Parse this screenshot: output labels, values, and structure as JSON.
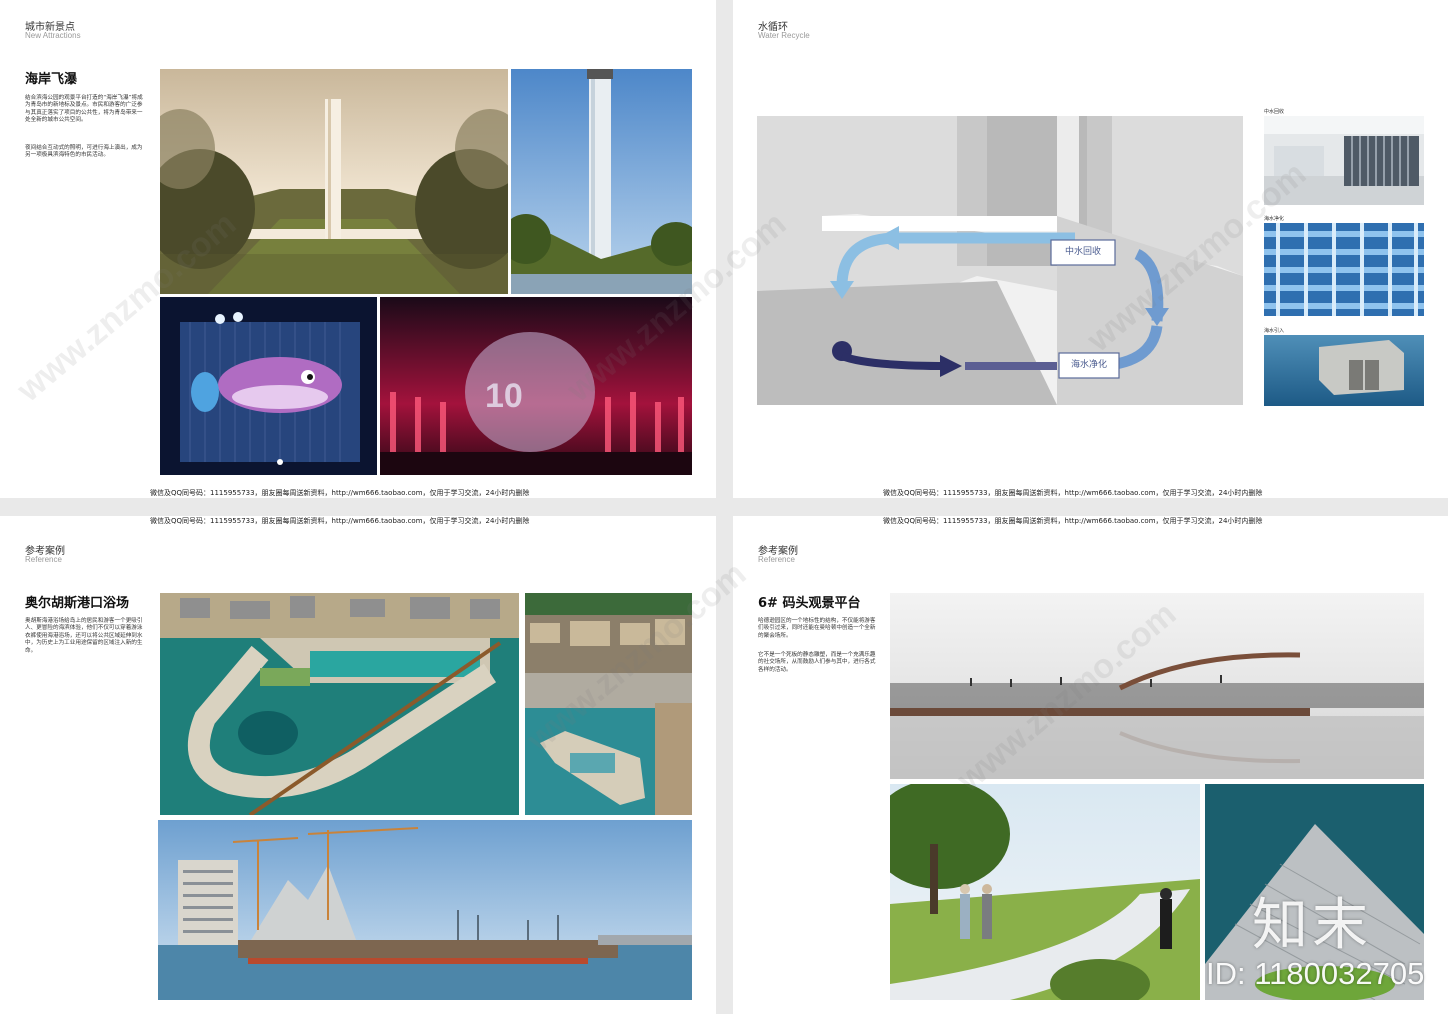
{
  "footer_text": "微信及QQ同号码：1115955733，朋友圈每周送新资料，http://wm666.taobao.com，仅用于学习交流，24小时内删除",
  "page1": {
    "header_cn": "城市新景点",
    "header_en": "New Attractions",
    "title": "海岸飞瀑",
    "para1": "结合滨海公园的观景平台打造的“海岸飞瀑”将成为青岛市的新地标及景点。市民和游客的广泛参与其真正落实了项目的公共性，将为青岛带来一处全新的城市公共空间。",
    "para2": "夜间结合互动式的照明，可进行海上演出，成为另一项极具滨海特色的市民活动。"
  },
  "page2": {
    "header_cn": "水循环",
    "header_en": "Water Recycle",
    "label_reclaimed": "中水回收",
    "label_desal": "海水净化",
    "cap1": "中水回收",
    "cap2": "海水净化",
    "cap3": "海水引入"
  },
  "page3": {
    "header_cn": "参考案例",
    "header_en": "Reference",
    "title": "奥尔胡斯港口浴场",
    "para1": "奥胡斯海港浴场给岛上的居民和游客一个更吸引人、更冒险的海滨体验，他们不仅可以穿着游泳衣裤使用海港浴场，还可以将公共区域延伸到水中，为历史上为工业用途保留的区域注入新的生命。"
  },
  "page4": {
    "header_cn": "参考案例",
    "header_en": "Reference",
    "title": "6# 码头观景平台",
    "para1": "哈德逊园区的一个地标性的结构，不仅能将游客们吸引过来，同时还能在曼哈顿中创造一个全新的聚会场所。",
    "para2": "它不是一个死板的静态雕塑，而是一个充满乐趣的社交场所，从而鼓励人们参与其中，进行各式各样的活动。"
  },
  "watermark": {
    "site": "www.znzmo.com",
    "brand": "知末",
    "id": "ID: 1180032705"
  },
  "colors": {
    "arrow_light": "#8cbfe3",
    "arrow_mid": "#6f9bd0",
    "arrow_dark": "#2c2f66",
    "label_border": "#5a6a9a"
  }
}
